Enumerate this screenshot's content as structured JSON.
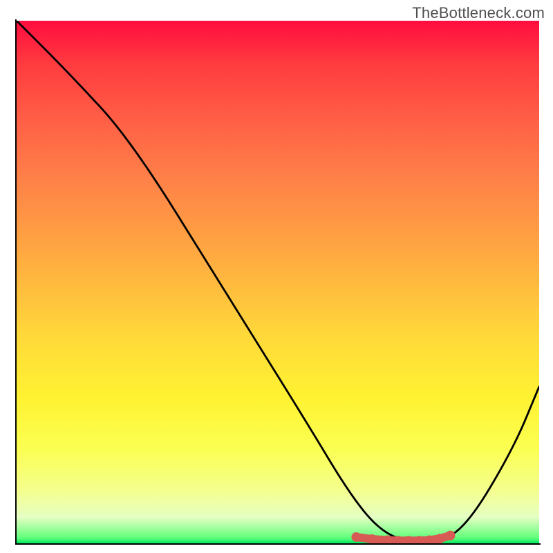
{
  "watermark": "TheBottleneck.com",
  "chart_data": {
    "type": "line",
    "title": "",
    "xlabel": "",
    "ylabel": "",
    "xlim": [
      0,
      100
    ],
    "ylim": [
      0,
      100
    ],
    "grid": false,
    "series": [
      {
        "name": "bottleneck-curve",
        "x": [
          0,
          10,
          22,
          40,
          55,
          64,
          70,
          76,
          80,
          86,
          95,
          100
        ],
        "values": [
          100,
          90,
          77,
          48,
          24,
          9,
          2,
          0,
          0,
          3,
          18,
          30
        ]
      }
    ],
    "markers": {
      "name": "optimal-range-dots",
      "x": [
        65,
        68,
        71,
        73,
        75,
        77,
        79,
        81,
        83
      ],
      "values": [
        1.2,
        0.8,
        0.6,
        0.5,
        0.5,
        0.5,
        0.6,
        0.9,
        1.5
      ],
      "color": "#d85a55"
    },
    "gradient_stops": [
      {
        "pos": 0,
        "color": "#ff0c3f"
      },
      {
        "pos": 18,
        "color": "#ff5c45"
      },
      {
        "pos": 47,
        "color": "#ffb040"
      },
      {
        "pos": 72,
        "color": "#fff232"
      },
      {
        "pos": 95,
        "color": "#e6ffc3"
      },
      {
        "pos": 100,
        "color": "#00e85e"
      }
    ]
  }
}
